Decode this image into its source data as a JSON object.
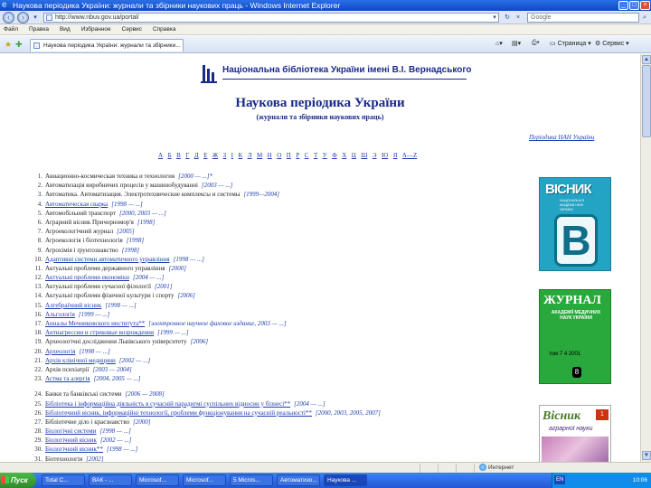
{
  "window": {
    "title": "Наукова періодика України: журнали та збірники наукових праць - Windows Internet Explorer",
    "min": "_",
    "max": "□",
    "close": "×"
  },
  "browser": {
    "back": "‹",
    "forward": "›",
    "address": "http://www.nbuv.gov.ua/portal/",
    "search_value": "Google",
    "go": "→",
    "menu": [
      "Файл",
      "Правка",
      "Вид",
      "Избранное",
      "Сервис",
      "Справка"
    ],
    "tab_title": "Наукова періодика України: журнали та збірники...",
    "commands": [
      "Страница",
      "Сервис"
    ]
  },
  "page": {
    "library_name": "Національна бібліотека України імені В.І. Вернадського",
    "title": "Наукова періодика України",
    "subtitle": "(журнали та збірники наукових праць)",
    "archive_link": "Періодика НАН України",
    "alphabet": [
      "А",
      "Б",
      "В",
      "Г",
      "Д",
      "Е",
      "Ж",
      "З",
      "І",
      "К",
      "Л",
      "М",
      "Н",
      "О",
      "П",
      "Р",
      "С",
      "Т",
      "У",
      "Ф",
      "Х",
      "Ц",
      "Ш",
      "Э",
      "Ю",
      "Я",
      "A—Z"
    ],
    "journals": [
      {
        "n": "1.",
        "title": "Авиационно-космическая техника и технология",
        "years": "[2000 — ...]*",
        "link": false
      },
      {
        "n": "2.",
        "title": "Автоматизація виробничих процесів у машинобудуванні",
        "years": "[2003 — ...]",
        "link": false
      },
      {
        "n": "3.",
        "title": "Автоматика. Автоматизация. Электротехнические комплексы и системы",
        "years": "[1999—2004]",
        "link": false
      },
      {
        "n": "4.",
        "title": "Автоматическая сварка",
        "years": "[1998 — ...]",
        "link": true
      },
      {
        "n": "5.",
        "title": "Автомобільний транспорт",
        "years": "[2000, 2003 — ...]",
        "link": false
      },
      {
        "n": "6.",
        "title": "Аграрний вісник Причорномор'я",
        "years": "[1998]",
        "link": false
      },
      {
        "n": "7.",
        "title": "Агроекологічний журнал",
        "years": "[2005]",
        "link": false
      },
      {
        "n": "8.",
        "title": "Агроекологія і біотехнологія",
        "years": "[1998]",
        "link": false
      },
      {
        "n": "9.",
        "title": "Агрохімія і ґрунтознавство",
        "years": "[1998]",
        "link": false
      },
      {
        "n": "10.",
        "title": "Адаптивні системи автоматичного управління",
        "years": "[1998 — ...]",
        "link": true
      },
      {
        "n": "11.",
        "title": "Актуальні проблеми державного управління",
        "years": "[2000]",
        "link": false
      },
      {
        "n": "12.",
        "title": "Актуальні проблеми економіки",
        "years": "[2004 — ...]",
        "link": true
      },
      {
        "n": "13.",
        "title": "Актуальні проблеми сучасної філології",
        "years": "[2001]",
        "link": false
      },
      {
        "n": "14.",
        "title": "Актуальні проблеми фізичної культури і спорту",
        "years": "[2006]",
        "link": false
      },
      {
        "n": "15.",
        "title": "Алгебраїчний вісник",
        "years": "[1998 — ...]",
        "link": true
      },
      {
        "n": "16.",
        "title": "Альгологія",
        "years": "[1999 — ...]",
        "link": true
      },
      {
        "n": "17.",
        "title": "Анналы Мечниковского института**",
        "years": "[электронное научное фаховое издание, 2003 — ...]",
        "link": true
      },
      {
        "n": "18.",
        "title": "Антиагрессии и стрековые возрождения",
        "years": "[1999 — ...]",
        "link": true
      },
      {
        "n": "19.",
        "title": "Археологічні дослідження Львівського університету",
        "years": "[2006]",
        "link": false
      },
      {
        "n": "20.",
        "title": "Археологія",
        "years": "[1998 — ...]",
        "link": true
      },
      {
        "n": "21.",
        "title": "Архів клінічної медицини",
        "years": "[2002 — ...]",
        "link": true
      },
      {
        "n": "22.",
        "title": "Архів психіатрії",
        "years": "[2003 — 2004]",
        "link": false
      },
      {
        "n": "23.",
        "title": "Астма та алергія",
        "years": "[2004, 2005 — ...]",
        "link": true
      },
      {
        "n": "24.",
        "title": "Банки та банківські системи",
        "years": "[2006 — 2008]",
        "link": false
      },
      {
        "n": "25.",
        "title": "Бібліотека і інформаційна діяльність в сучасній парадигмі суспільних відносин у бізнесі**",
        "years": "[2004 — ...]",
        "link": true
      },
      {
        "n": "26.",
        "title": "Бібліотечний вісник, інформаційні технології, проблеми функціонування на сучасній реальності**",
        "years": "[2000, 2003, 2005, 2007]",
        "link": true
      },
      {
        "n": "27.",
        "title": "Бібліотечне діло і краєзнавство",
        "years": "[2000]",
        "link": false
      },
      {
        "n": "28.",
        "title": "Біологічні системи",
        "years": "[1998 — ...]",
        "link": true
      },
      {
        "n": "29.",
        "title": "Біологічний вісник",
        "years": "[2002 — ...]",
        "link": true
      },
      {
        "n": "30.",
        "title": "Біологічний вісник**",
        "years": "[1998 — ...]",
        "link": true
      },
      {
        "n": "31.",
        "title": "Біотехнологія",
        "years": "[2002]",
        "link": false
      }
    ],
    "covers": {
      "c1_title": "ВІСНИК",
      "c1_sub": "НАЦІОНАЛЬНОЇ АКАДЕМІЇ НАУК УКРАЇНИ",
      "c1_letter": "В",
      "c2_title": "ЖУРНАЛ",
      "c2_sub": "АКАДЕМІЇ МЕДИЧНИХ НАУК УКРАЇНИ",
      "c2_num": "том 7  4  2001",
      "c2_badge": "8",
      "c3_title": "Вісник",
      "c3_sub": "аграрної науки",
      "c3_badge": "1"
    }
  },
  "status": {
    "zone": "Интернет"
  },
  "taskbar": {
    "start": "Пуск",
    "tasks": [
      "Total C...",
      "ВАК - ...",
      "Microsof...",
      "Microsof...",
      "5 Micros...",
      "Автоматизо...",
      "Наукова ..."
    ],
    "language": "EN",
    "clock": "10:06"
  },
  "colors": {
    "link": "#1d3db0",
    "heading": "#1a2a8a",
    "titlebar": "#0c49c4"
  }
}
